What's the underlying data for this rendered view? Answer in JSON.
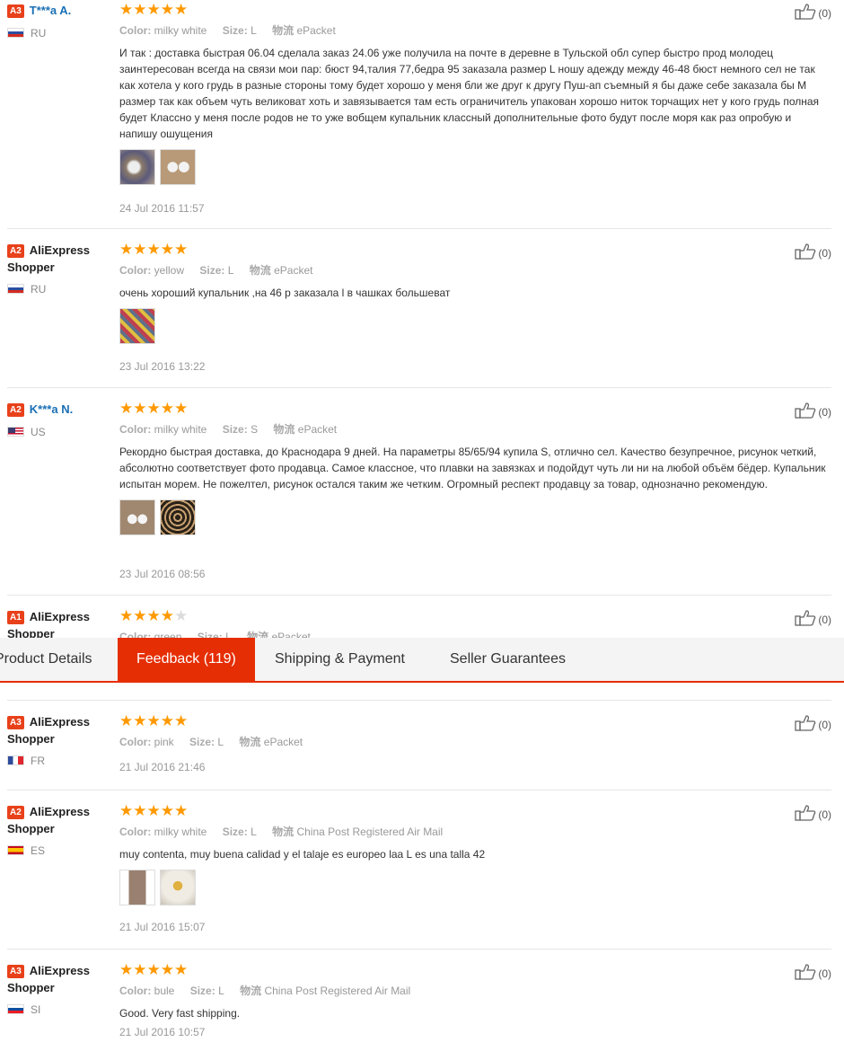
{
  "tabs": {
    "product_details": "Product Details",
    "feedback": "Feedback (119)",
    "shipping": "Shipping & Payment",
    "guarantees": "Seller Guarantees"
  },
  "labels": {
    "color": "Color:",
    "size": "Size:",
    "logistics": "物流"
  },
  "reviews": [
    {
      "level": "A3",
      "name": "T***a A.",
      "country": "RU",
      "stars": 5,
      "color": "milky white",
      "size": "L",
      "shipping": "ePacket",
      "text": "И так : доставка быстрая 06.04 сделала заказ 24.06 уже получила на почте в деревне в Тульской обл супер быстро прод молодец заинтересован всегда на связи мои пар: бюст 94,талия 77,бедра 95 заказала размер L ношу адежду между 46-48 бюст немного сел не так как хотела у кого грудь в разные стороны тому будет хорошо у меня бли же друг к другу Пуш-ап съемный я бы даже себе заказала бы M размер так как объем чуть великоват хоть и завязывается там есть ограничитель упакован хорошо ниток торчащих нет у кого грудь полная будет Классно у меня после родов не то уже вобщем купальник классный дополнительные фото будут после моря как раз опробую и напишу ошущения",
      "photos": 2,
      "date": "24 Jul 2016 11:57",
      "likes": "(0)"
    },
    {
      "level": "A2",
      "name": "AliExpress Shopper",
      "country": "RU",
      "stars": 5,
      "color": "yellow",
      "size": "L",
      "shipping": "ePacket",
      "text": "очень хороший купальник ,на 46 р заказала l в чашках большеват",
      "photos": 1,
      "date": "23 Jul 2016 13:22",
      "likes": "(0)"
    },
    {
      "level": "A2",
      "name": "K***a N.",
      "country": "US",
      "stars": 5,
      "color": "milky white",
      "size": "S",
      "shipping": "ePacket",
      "text": "Рекордно быстрая доставка, до Краснодара 9 дней. На параметры 85/65/94 купила S, отлично сел. Качество безупречное, рисунок четкий, абсолютно соответствует фото продавца. Самое классное, что плавки на завязках и подойдут чуть ли ни на любой объём бёдер. Купальник испытан морем. Не пожелтел, рисунок остался таким же четким. Огромный респект продавцу за товар, однозначно рекомендую.",
      "photos": 2,
      "date": "23 Jul 2016 08:56",
      "likes": "(0)"
    },
    {
      "level": "A1",
      "name": "AliExpress Shopper",
      "country": "",
      "stars": 4,
      "color": "green",
      "size": "L",
      "shipping": "ePacket",
      "text": "",
      "photos": 0,
      "date": "",
      "likes": "(0)"
    },
    {
      "level": "A3",
      "name": "AliExpress Shopper",
      "country": "FR",
      "stars": 5,
      "color": "pink",
      "size": "L",
      "shipping": "ePacket",
      "text": "",
      "photos": 0,
      "date": "21 Jul 2016 21:46",
      "likes": "(0)"
    },
    {
      "level": "A2",
      "name": "AliExpress Shopper",
      "country": "ES",
      "stars": 5,
      "color": "milky white",
      "size": "L",
      "shipping": "China Post Registered Air Mail",
      "text": "muy contenta, muy buena calidad y el talaje es europeo laa L es una talla 42",
      "photos": 2,
      "date": "21 Jul 2016 15:07",
      "likes": "(0)"
    },
    {
      "level": "A3",
      "name": "AliExpress Shopper",
      "country": "SI",
      "stars": 5,
      "color": "bule",
      "size": "L",
      "shipping": "China Post Registered Air Mail",
      "text": "Good. Very fast shipping.",
      "photos": 0,
      "date": "21 Jul 2016 10:57",
      "likes": "(0)"
    }
  ]
}
